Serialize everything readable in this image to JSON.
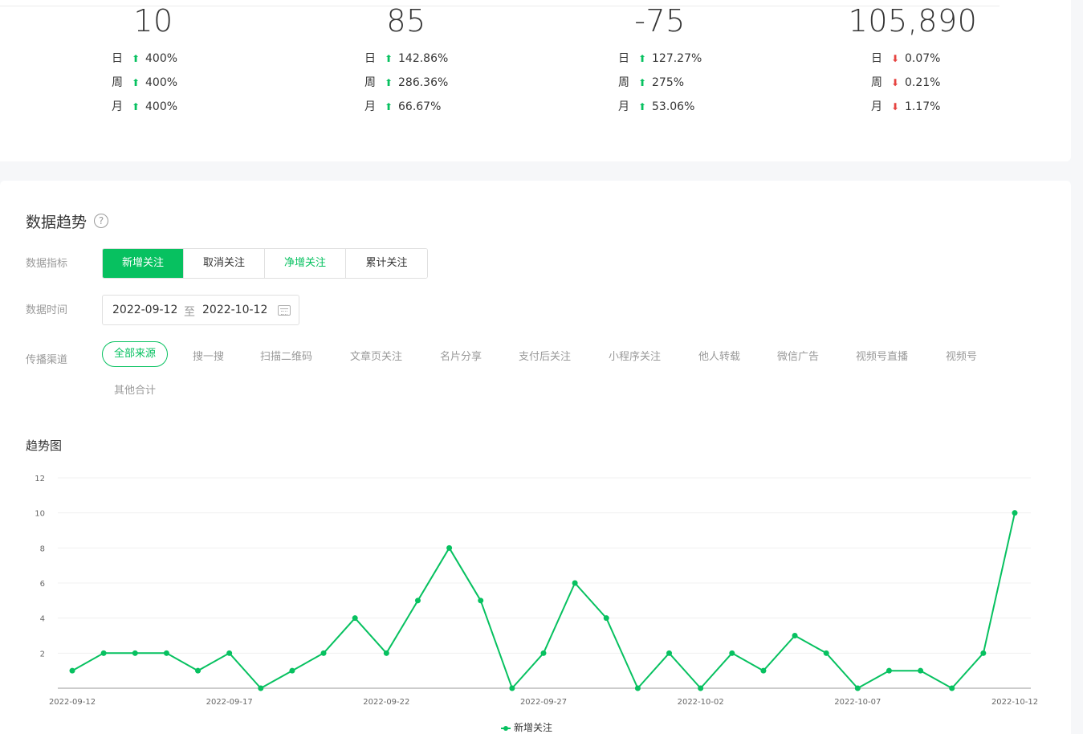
{
  "stats": [
    {
      "value": "10",
      "rows": [
        {
          "label": "日",
          "dir": "up",
          "pct": "400%"
        },
        {
          "label": "周",
          "dir": "up",
          "pct": "400%"
        },
        {
          "label": "月",
          "dir": "up",
          "pct": "400%"
        }
      ]
    },
    {
      "value": "85",
      "rows": [
        {
          "label": "日",
          "dir": "up",
          "pct": "142.86%"
        },
        {
          "label": "周",
          "dir": "up",
          "pct": "286.36%"
        },
        {
          "label": "月",
          "dir": "up",
          "pct": "66.67%"
        }
      ]
    },
    {
      "value": "-75",
      "rows": [
        {
          "label": "日",
          "dir": "up",
          "pct": "127.27%"
        },
        {
          "label": "周",
          "dir": "up",
          "pct": "275%"
        },
        {
          "label": "月",
          "dir": "up",
          "pct": "53.06%"
        }
      ]
    },
    {
      "value": "105,890",
      "rows": [
        {
          "label": "日",
          "dir": "down",
          "pct": "0.07%"
        },
        {
          "label": "周",
          "dir": "down",
          "pct": "0.21%"
        },
        {
          "label": "月",
          "dir": "down",
          "pct": "1.17%"
        }
      ]
    }
  ],
  "trend": {
    "title": "数据趋势",
    "help_icon": "?",
    "metric_label": "数据指标",
    "metrics": [
      "新增关注",
      "取消关注",
      "净增关注",
      "累计关注"
    ],
    "time_label": "数据时间",
    "date_start": "2022-09-12",
    "date_sep": "至",
    "date_end": "2022-10-12",
    "channel_label": "传播渠道",
    "channels": [
      "全部来源",
      "搜一搜",
      "扫描二维码",
      "文章页关注",
      "名片分享",
      "支付后关注",
      "小程序关注",
      "他人转载",
      "微信广告",
      "视频号直播",
      "视频号",
      "其他合计"
    ],
    "chart_title": "趋势图"
  },
  "colors": {
    "accent": "#07c160",
    "up": "#07c160",
    "down": "#e64340"
  },
  "chart_data": {
    "type": "line",
    "x": [
      "2022-09-12",
      "2022-09-13",
      "2022-09-14",
      "2022-09-15",
      "2022-09-16",
      "2022-09-17",
      "2022-09-18",
      "2022-09-19",
      "2022-09-20",
      "2022-09-21",
      "2022-09-22",
      "2022-09-23",
      "2022-09-24",
      "2022-09-25",
      "2022-09-26",
      "2022-09-27",
      "2022-09-28",
      "2022-09-29",
      "2022-09-30",
      "2022-10-01",
      "2022-10-02",
      "2022-10-03",
      "2022-10-04",
      "2022-10-05",
      "2022-10-06",
      "2022-10-07",
      "2022-10-08",
      "2022-10-09",
      "2022-10-10",
      "2022-10-11",
      "2022-10-12"
    ],
    "x_tick_labels": [
      "2022-09-12",
      "2022-09-17",
      "2022-09-22",
      "2022-09-27",
      "2022-10-02",
      "2022-10-07",
      "2022-10-12"
    ],
    "series": [
      {
        "name": "新增关注",
        "values": [
          1,
          2,
          2,
          2,
          1,
          2,
          0,
          1,
          2,
          4,
          2,
          5,
          8,
          5,
          0,
          2,
          6,
          4,
          0,
          2,
          0,
          2,
          1,
          3,
          2,
          0,
          1,
          1,
          0,
          2,
          10
        ]
      }
    ],
    "ylim": [
      0,
      12
    ],
    "y_ticks": [
      2,
      4,
      6,
      8,
      10,
      12
    ],
    "grid": true,
    "legend": "bottom"
  }
}
